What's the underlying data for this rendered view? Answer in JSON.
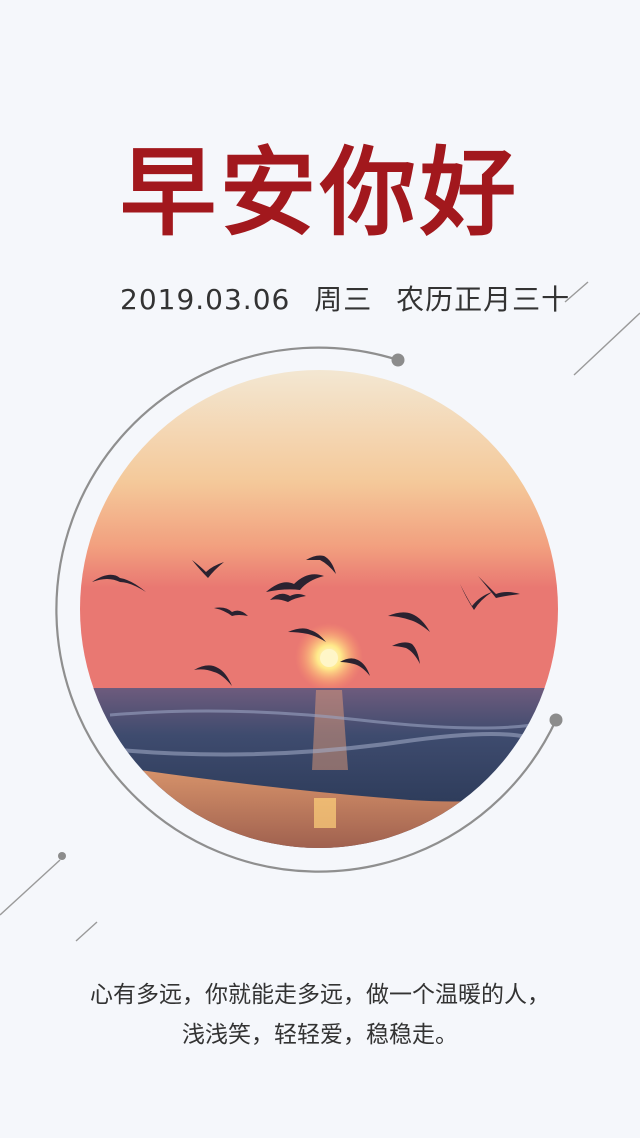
{
  "greeting": "早安你好",
  "date": {
    "gregorian": "2019.03.06",
    "weekday": "周三",
    "lunar": "农历正月三十"
  },
  "image": {
    "subject": "sunset-sea-birds",
    "colors": {
      "sky_top": "#f4e6cf",
      "sky_mid": "#f4b48a",
      "sky_low": "#ec7a73",
      "sea": "#3b4a6b",
      "sun": "#fff6c8"
    }
  },
  "quote": {
    "line1": "心有多远，你就能走多远，做一个温暖的人，",
    "line2": "浅浅笑，轻轻爱，稳稳走。"
  },
  "colors": {
    "title": "#a2181d",
    "text": "#333333",
    "ring": "#8a8a8a",
    "background": "#f5f7fb"
  }
}
